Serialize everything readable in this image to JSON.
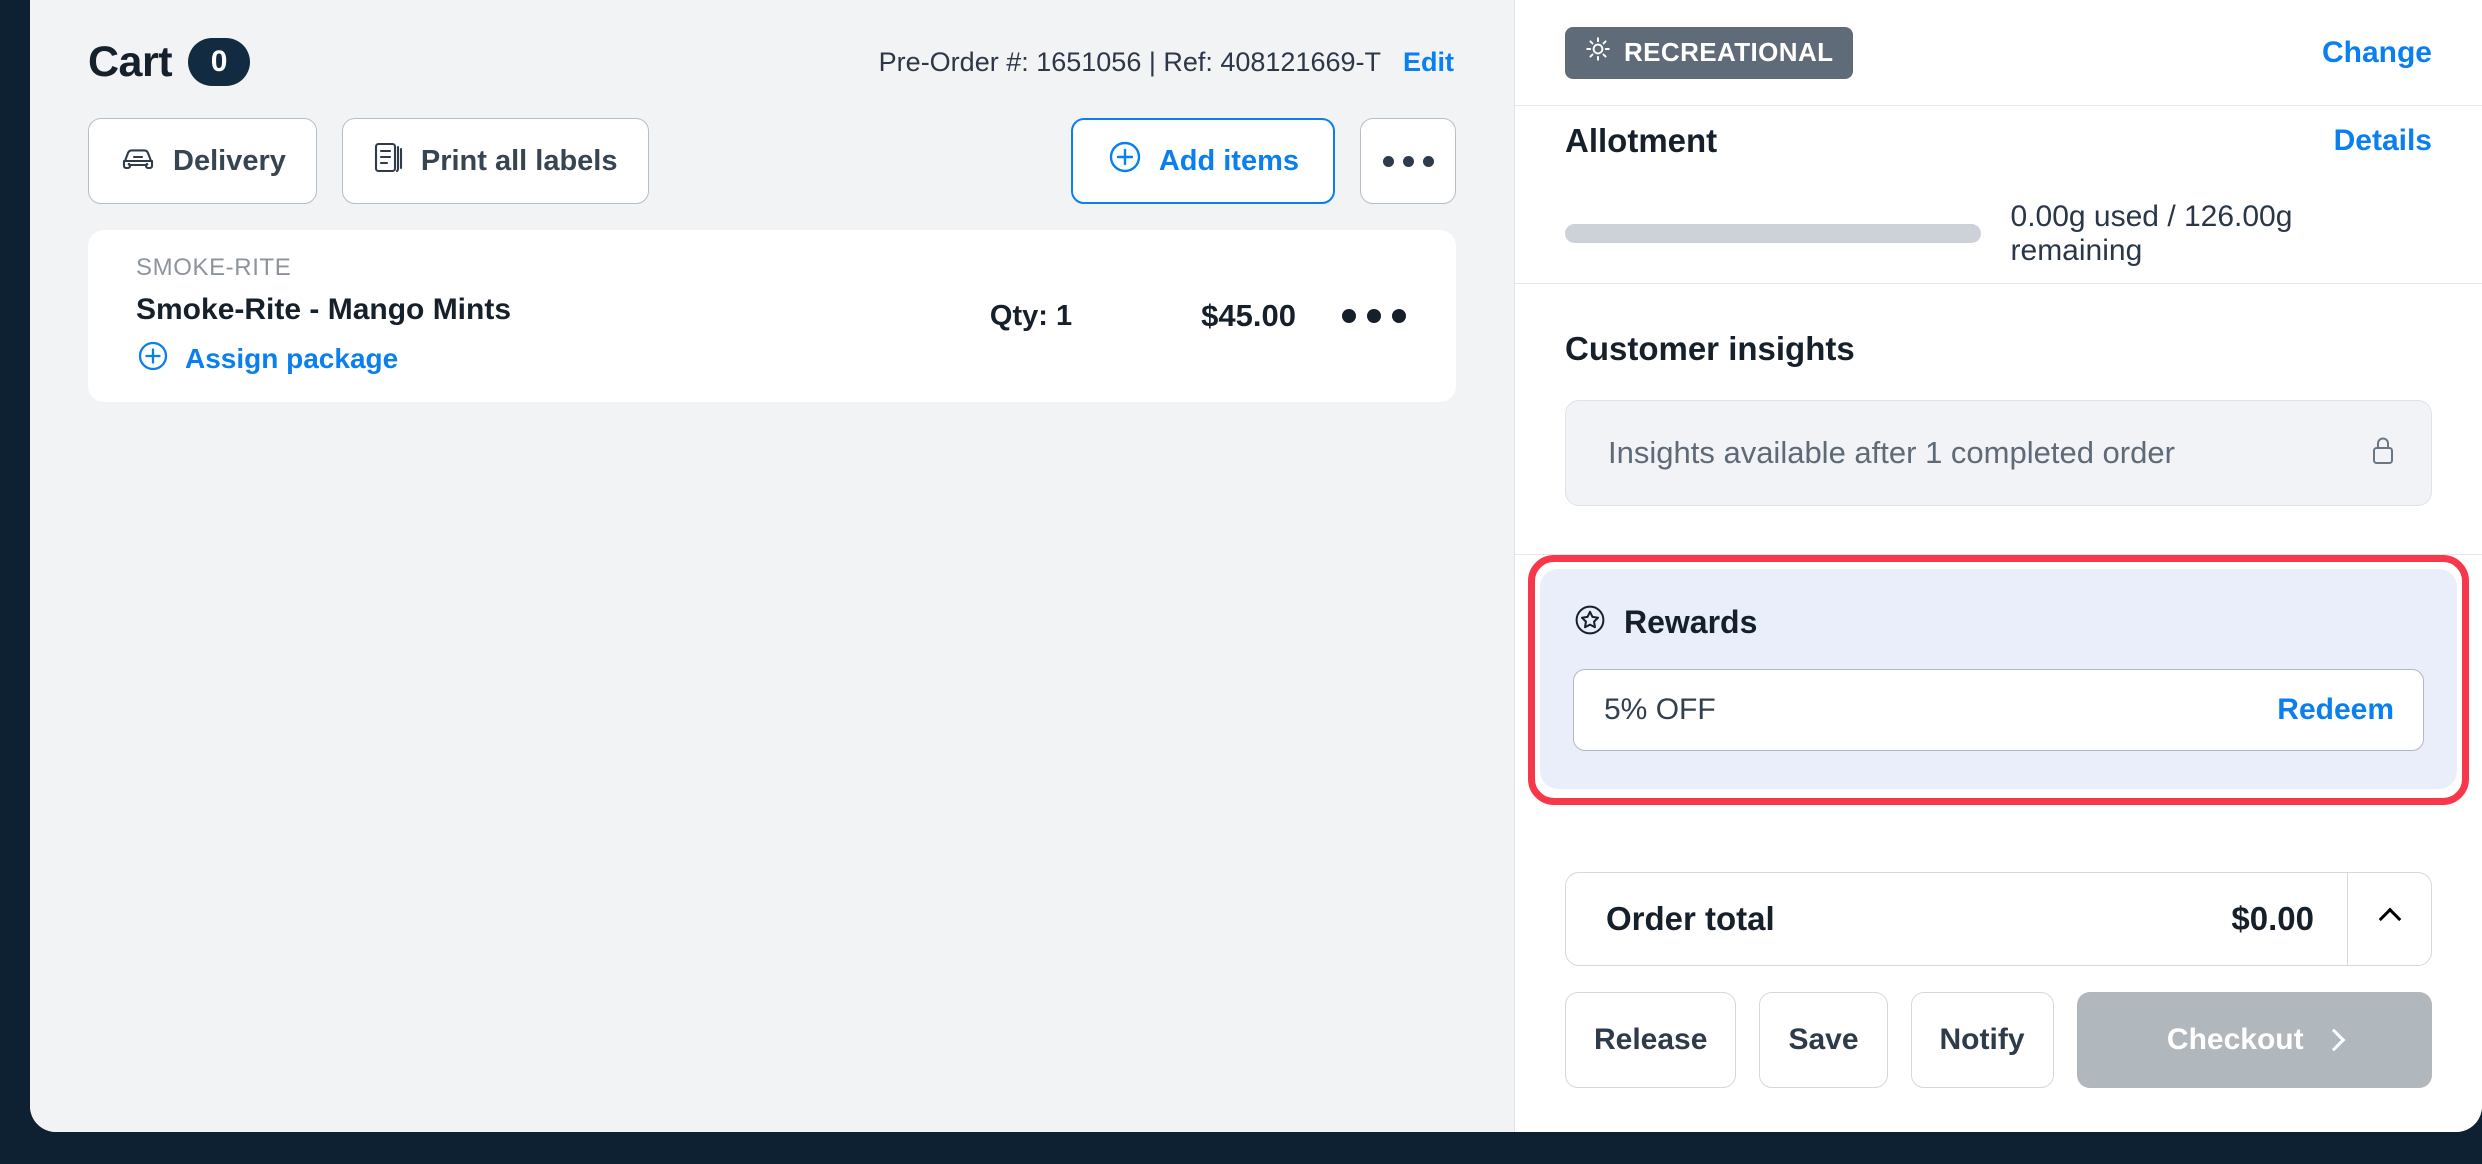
{
  "cart": {
    "title": "Cart",
    "count": "0",
    "order_meta": "Pre-Order #: 1651056 | Ref: 408121669-T",
    "edit_label": "Edit",
    "toolbar": {
      "delivery_label": "Delivery",
      "print_labels_label": "Print all labels",
      "add_items_label": "Add items",
      "more_label": "•••"
    },
    "items": [
      {
        "brand": "SMOKE-RITE",
        "name": "Smoke-Rite - Mango Mints",
        "assign_label": "Assign package",
        "qty": "Qty: 1",
        "price": "$45.00"
      }
    ]
  },
  "side": {
    "customer_type_badge": "RECREATIONAL",
    "change_label": "Change",
    "allotment": {
      "title": "Allotment",
      "details_label": "Details",
      "progress_percent": 0,
      "usage_text": "0.00g used / 126.00g remaining"
    },
    "customer_insights": {
      "title": "Customer insights",
      "locked_text": "Insights available after 1 completed order"
    },
    "rewards": {
      "title": "Rewards",
      "items": [
        {
          "label": "5% OFF",
          "action_label": "Redeem"
        }
      ]
    },
    "order_total": {
      "label": "Order total",
      "value": "$0.00"
    },
    "actions": {
      "release_label": "Release",
      "save_label": "Save",
      "notify_label": "Notify",
      "checkout_label": "Checkout"
    }
  },
  "colors": {
    "accent_blue": "#0a7ff0",
    "highlight_red": "#f7384b",
    "frame_navy": "#0e2132",
    "badge_gray": "#5f6b78"
  }
}
